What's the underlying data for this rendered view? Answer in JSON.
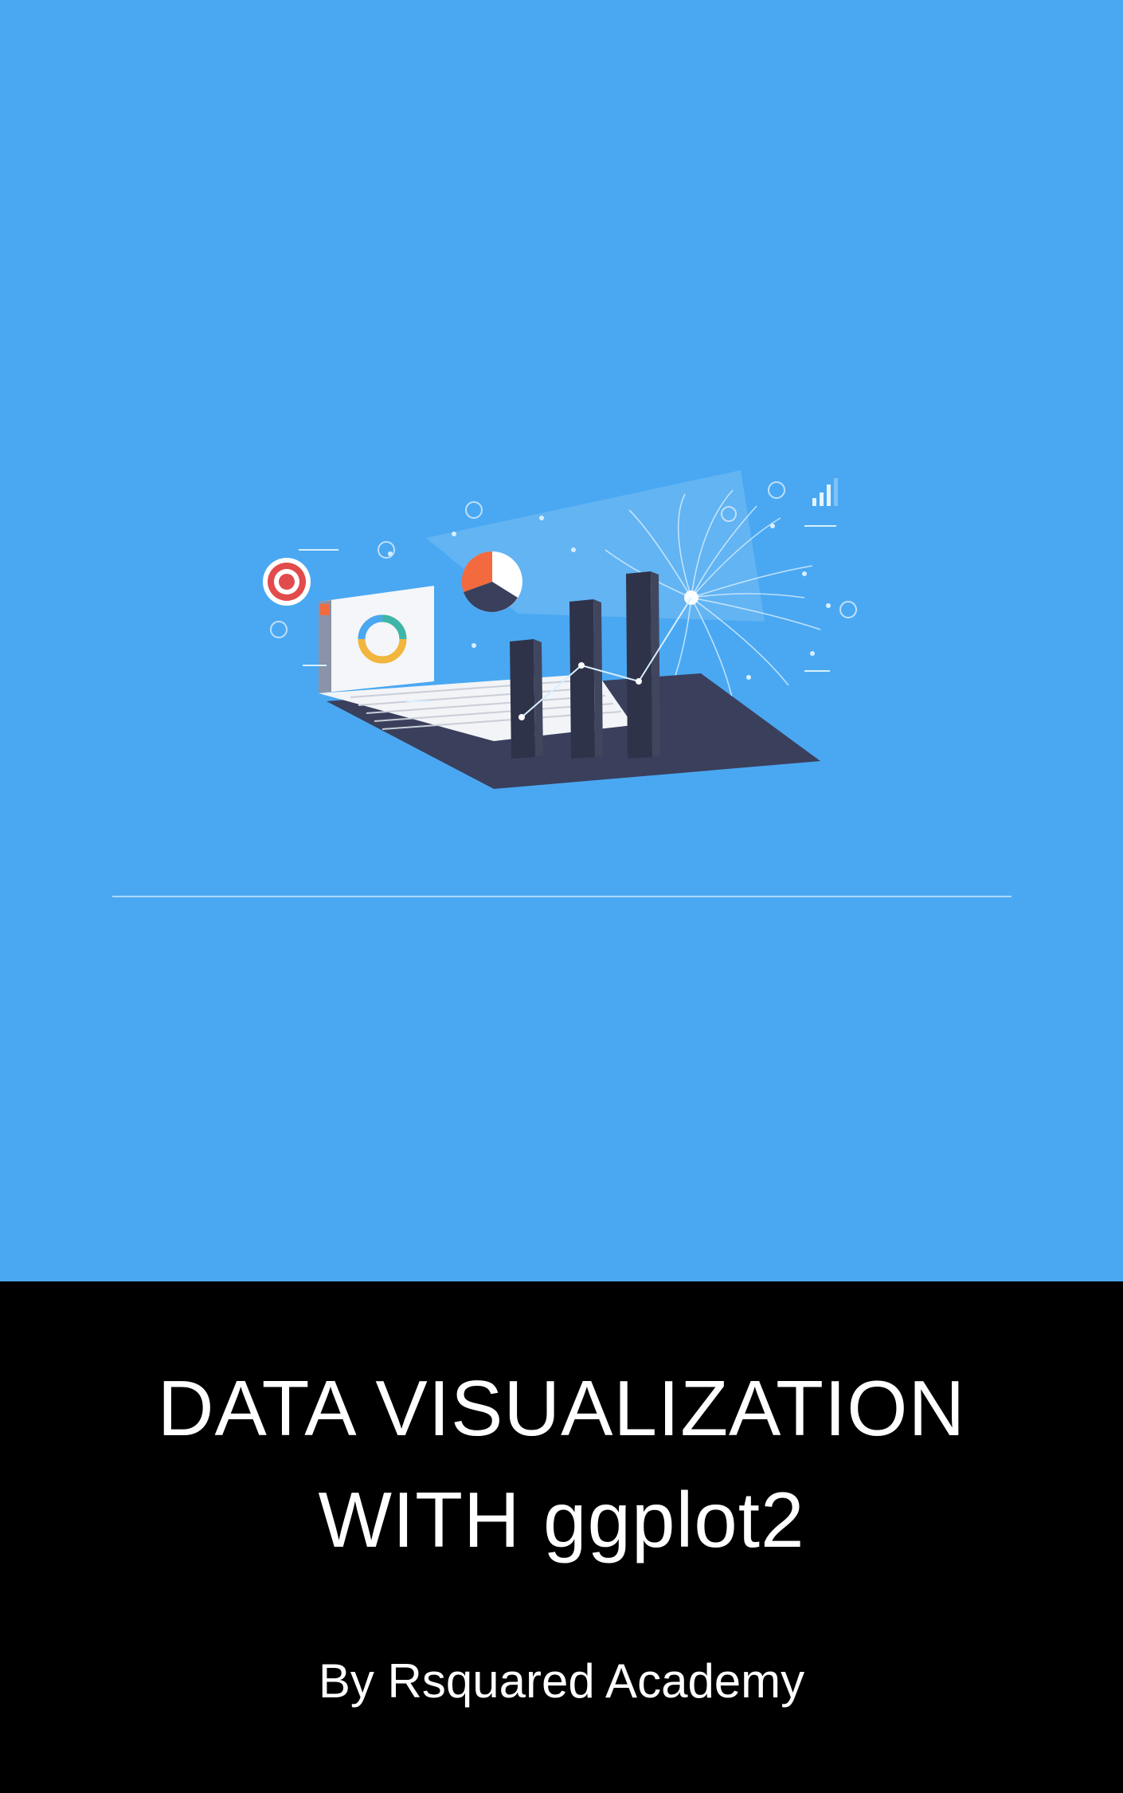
{
  "cover": {
    "title_line1": "DATA VISUALIZATION",
    "title_line2": "WITH ggplot2",
    "author": "By Rsquared Academy"
  },
  "colors": {
    "top_background": "#4aa8f2",
    "bottom_background": "#000000",
    "text": "#ffffff",
    "bar": "#33374f",
    "accent_orange": "#f26a3d",
    "accent_red": "#e24b4b"
  },
  "illustration": {
    "icon": "analytics-dashboard-illustration",
    "elements": [
      "target-icon",
      "dashboard-card-icon",
      "pie-chart-icon",
      "bar-chart-icon",
      "mini-bars-icon",
      "light-burst-icon"
    ]
  }
}
